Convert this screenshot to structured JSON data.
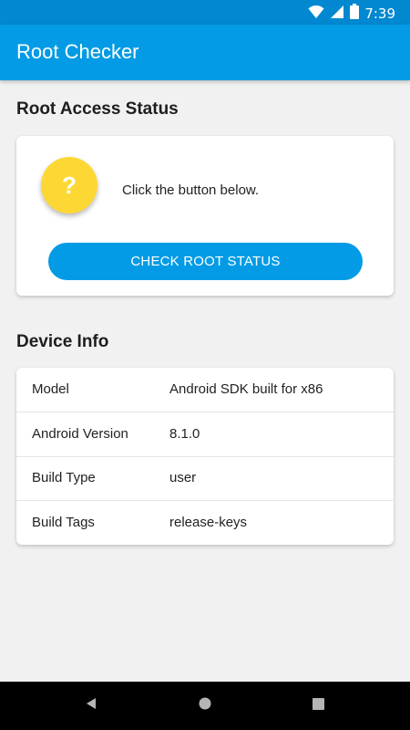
{
  "status_bar": {
    "time": "7:39",
    "icons": [
      "wifi-icon",
      "signal-icon",
      "battery-icon"
    ]
  },
  "app_bar": {
    "title": "Root Checker"
  },
  "root_section": {
    "title": "Root Access Status",
    "status_icon_symbol": "?",
    "status_message": "Click the button below.",
    "check_button_label": "CHECK ROOT STATUS"
  },
  "device_section": {
    "title": "Device Info",
    "rows": [
      {
        "label": "Model",
        "value": "Android SDK built for x86"
      },
      {
        "label": "Android Version",
        "value": "8.1.0"
      },
      {
        "label": "Build Type",
        "value": "user"
      },
      {
        "label": "Build Tags",
        "value": "release-keys"
      }
    ]
  },
  "nav_bar": {
    "buttons": [
      "back-icon",
      "home-icon",
      "recents-icon"
    ]
  },
  "colors": {
    "status_bar": "#0288d1",
    "app_bar": "#039be5",
    "accent": "#039be5",
    "status_circle": "#fdd835",
    "background": "#f1f1f1"
  }
}
